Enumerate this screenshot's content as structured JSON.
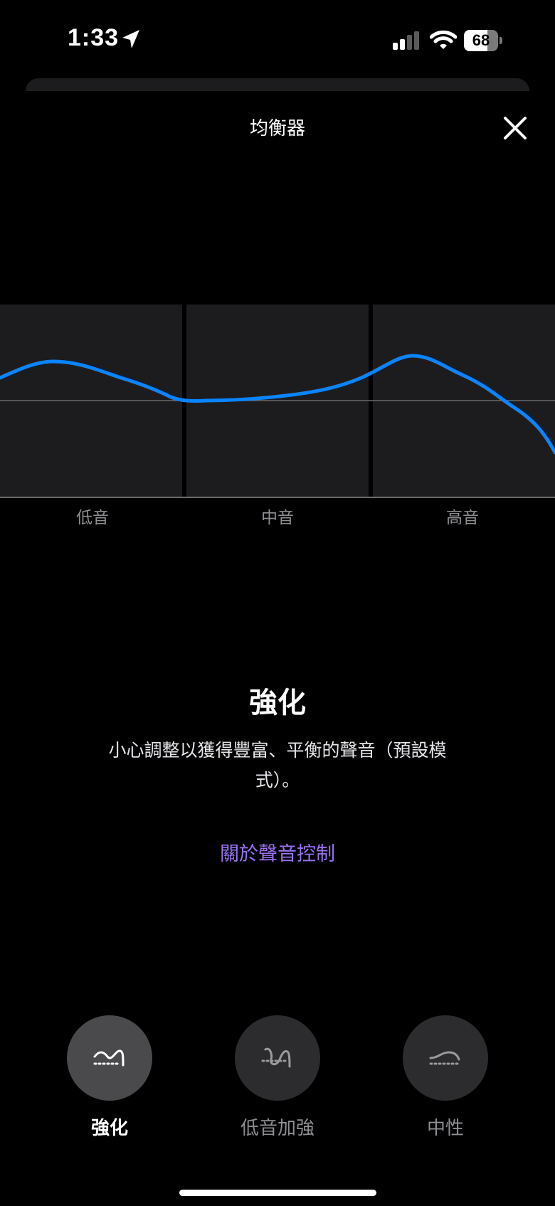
{
  "status_bar": {
    "time": "1:33",
    "battery": "68",
    "battery_level": 0.68
  },
  "sheet": {
    "title": "均衡器",
    "close_icon": "close-icon"
  },
  "equalizer": {
    "band_labels": [
      "低音",
      "中音",
      "高音"
    ],
    "curve_color": "#0a84ff"
  },
  "preset_info": {
    "title": "強化",
    "description": "小心調整以獲得豐富、平衡的聲音（預設模式）。",
    "about_link": "關於聲音控制"
  },
  "presets": [
    {
      "label": "強化",
      "selected": true,
      "icon": "enhance-icon"
    },
    {
      "label": "低音加強",
      "selected": false,
      "icon": "bass-boost-icon"
    },
    {
      "label": "中性",
      "selected": false,
      "icon": "neutral-icon"
    }
  ],
  "colors": {
    "accent_link": "#9b72f2",
    "curve": "#0a84ff",
    "background": "#000000"
  }
}
